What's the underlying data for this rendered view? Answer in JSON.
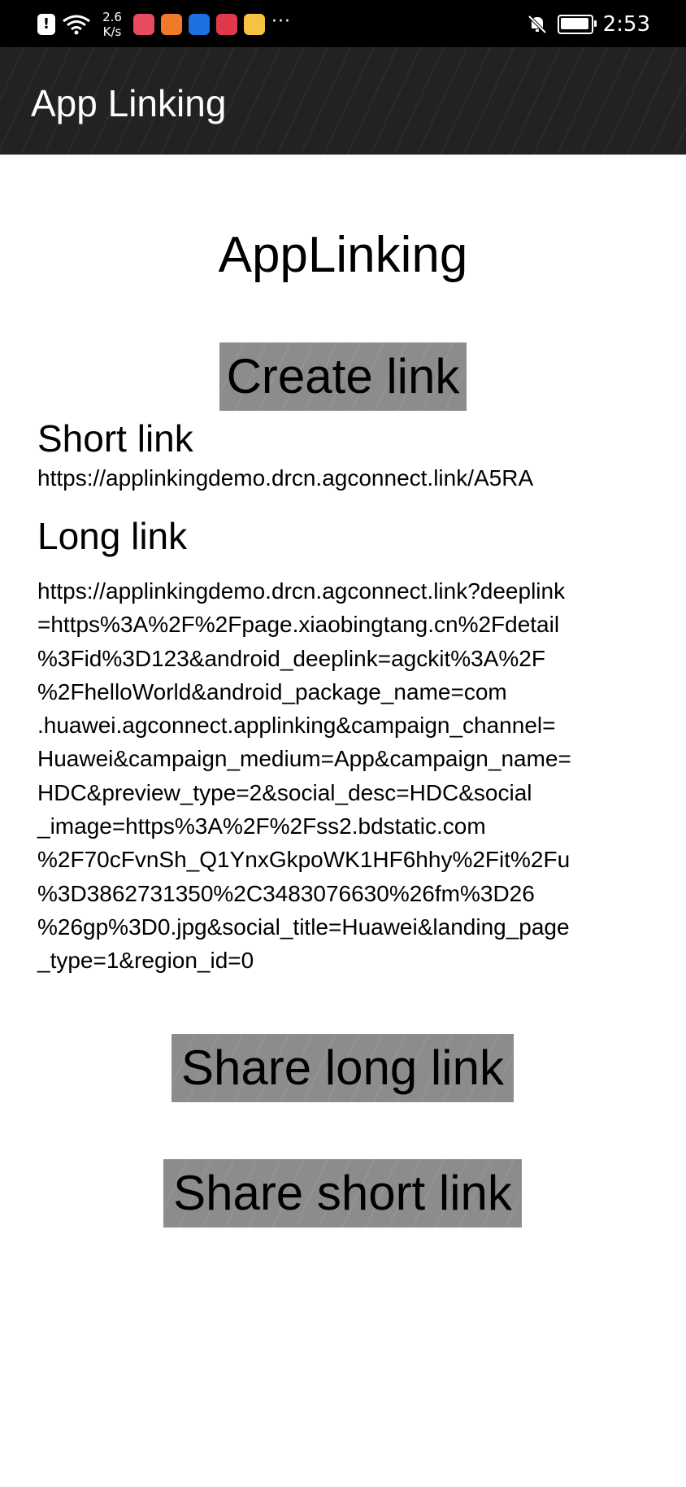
{
  "status_bar": {
    "net_speed_value": "2.6",
    "net_speed_unit": "K/s",
    "time": "2:53",
    "icons": [
      "alert-icon",
      "wifi-icon",
      "app-icon-1",
      "app-icon-2",
      "app-icon-3",
      "app-icon-4",
      "weibo-icon",
      "more-icon",
      "mute-icon",
      "battery-charging-icon"
    ],
    "more_dots": "···"
  },
  "app_bar": {
    "title": "App Linking"
  },
  "main": {
    "heading": "AppLinking",
    "create_button": "Create link",
    "short_link_label": "Short link",
    "short_link_value": "https://applinkingdemo.drcn.agconnect.link/A5RA",
    "long_link_label": "Long link",
    "long_link_value": "https://applinkingdemo.drcn.agconnect.link?deeplink\n=https%3A%2F%2Fpage.xiaobingtang.cn%2Fdetail\n%3Fid%3D123&android_deeplink=agckit%3A%2F\n%2FhelloWorld&android_package_name=com\n.huawei.agconnect.applinking&campaign_channel=\nHuawei&campaign_medium=App&campaign_name=\nHDC&preview_type=2&social_desc=HDC&social\n_image=https%3A%2F%2Fss2.bdstatic.com\n%2F70cFvnSh_Q1YnxGkpoWK1HF6hhy%2Fit%2Fu\n%3D3862731350%2C3483076630%26fm%3D26\n%26gp%3D0.jpg&social_title=Huawei&landing_page\n_type=1&region_id=0",
    "share_long_button": "Share long link",
    "share_short_button": "Share short link"
  }
}
